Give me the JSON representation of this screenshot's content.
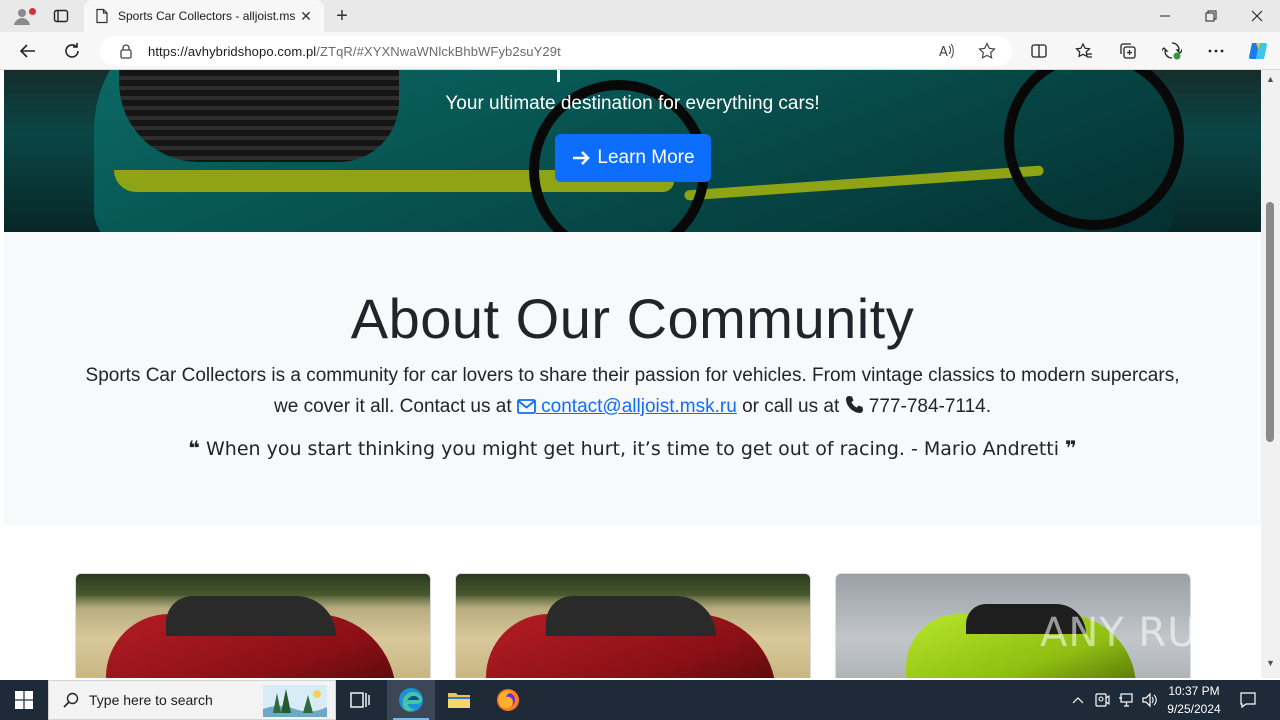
{
  "browser": {
    "tab_title": "Sports Car Collectors - alljoist.mѕ",
    "url_host": "https://avhybridshopo.com.pl",
    "url_path": "/ZTqR/#XYXNwaWNlckBhbWFyb2suY29t"
  },
  "hero": {
    "tagline": "Your ultimate destination for everything cars!",
    "button_label": "Learn More"
  },
  "about": {
    "heading": "About Our Community",
    "desc_part1": "Sports Car Collectors is a community for car lovers to share their passion for vehicles. From vintage classics to modern supercars, we cover it all. Contact us at ",
    "email": " contact@alljoist.msk.ru",
    "desc_part2": " or call us at ",
    "phone": " 777-784-7114",
    "desc_end": ".",
    "quote": " When you start thinking you might get hurt, it’s time to get out of racing. - Mario Andretti "
  },
  "watermark": "ANY RUN",
  "taskbar": {
    "search_placeholder": "Type here to search",
    "time": "10:37 PM",
    "date": "9/25/2024"
  },
  "colors": {
    "accent_button": "#0d6efd",
    "link": "#0d6efd",
    "about_bg": "#f8f9fa",
    "taskbar_bg": "#1f2a38"
  }
}
